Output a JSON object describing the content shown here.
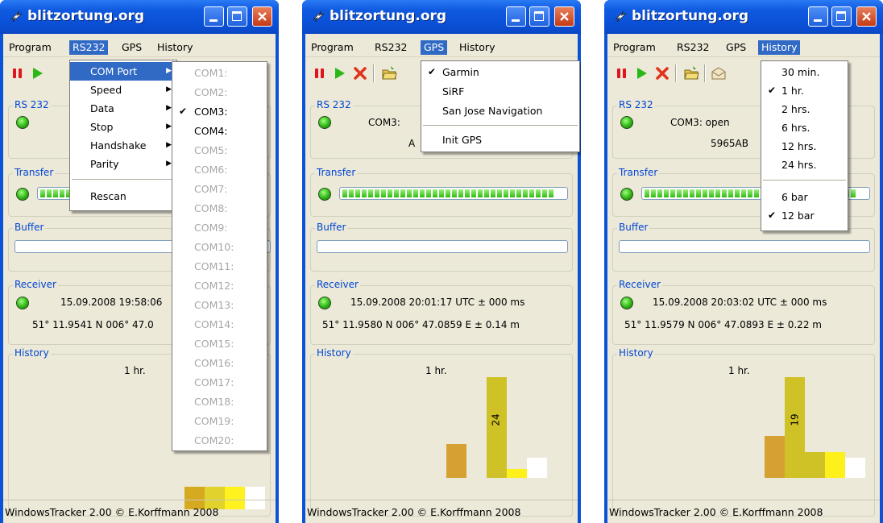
{
  "app": {
    "title": "blitzortung.org",
    "menus": [
      "Program",
      "RS232",
      "GPS",
      "History"
    ],
    "status": "WindowsTracker 2.00 © E.Korffmann 2008"
  },
  "windows": [
    {
      "groups": {
        "rs232": "RS 232",
        "transfer": "Transfer",
        "buffer": "Buffer",
        "receiver": "Receiver",
        "history": "History"
      },
      "receiver_time": "15.09.2008 19:58:06",
      "receiver_pos": "51° 11.9541 N  006° 47.0",
      "history_period": "1 hr.",
      "history_bars": [
        {
          "value": 20,
          "color": "#d6aa20"
        },
        {
          "value": 20,
          "color": "#e2d22c"
        },
        {
          "value": 20,
          "color": "#fff21e"
        },
        {
          "value": 20,
          "color": "#ffffff"
        }
      ],
      "rs232_menu": {
        "items": [
          "COM Port",
          "Speed",
          "Data",
          "Stop",
          "Handshake",
          "Parity",
          "Rescan"
        ]
      },
      "com_menu": {
        "items": [
          "COM1:",
          "COM2:",
          "COM3:",
          "COM4:",
          "COM5:",
          "COM6:",
          "COM7:",
          "COM8:",
          "COM9:",
          "COM10:",
          "COM11:",
          "COM12:",
          "COM13:",
          "COM14:",
          "COM15:",
          "COM16:",
          "COM17:",
          "COM18:",
          "COM19:",
          "COM20:"
        ],
        "checked": "COM3:"
      }
    },
    {
      "groups": {
        "rs232": "RS 232",
        "transfer": "Transfer",
        "buffer": "Buffer",
        "receiver": "Receiver",
        "history": "History"
      },
      "rs232_status": "COM3:",
      "rs232_id": "A",
      "receiver_time": "15.09.2008 20:01:17 UTC ± 000 ms",
      "receiver_pos": "51° 11.9580 N  006° 47.0859 E ± 0.14 m",
      "history_period": "1 hr.",
      "history_bar_label": "24",
      "gps_menu": {
        "items": [
          "Garmin",
          "SiRF",
          "San Jose Navigation",
          "Init GPS"
        ],
        "checked": "Garmin"
      }
    },
    {
      "groups": {
        "rs232": "RS 232",
        "transfer": "Transfer",
        "buffer": "Buffer",
        "receiver": "Receiver",
        "history": "History"
      },
      "rs232_status": "COM3: open",
      "rs232_id": "5965AB",
      "receiver_time": "15.09.2008 20:03:02 UTC ± 000 ms",
      "receiver_pos": "51° 11.9579 N  006° 47.0893 E ± 0.22 m",
      "history_period": "1 hr.",
      "history_bar_label": "19",
      "history_menu": {
        "items": [
          "30 min.",
          "1 hr.",
          "2 hrs.",
          "6 hrs.",
          "12 hrs.",
          "24 hrs.",
          "6 bar",
          "12 bar"
        ],
        "checked": [
          "1 hr.",
          "12 bar"
        ]
      }
    }
  ],
  "colors": {
    "titlebar": "#0a4fd6",
    "menu_highlight": "#316ac5",
    "group_label": "#0046d5",
    "history_bar_dark": "#d6a132",
    "history_bar_olive": "#cfc226",
    "history_bar_yellow": "#fdf01b",
    "history_bar_white": "#ffffff"
  }
}
